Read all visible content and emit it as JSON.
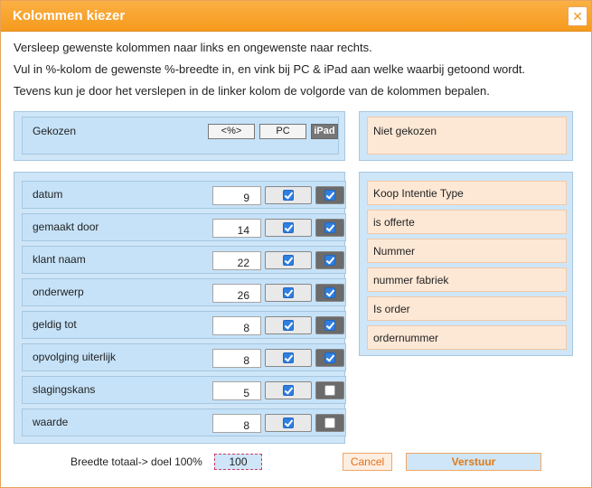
{
  "dialog": {
    "title": "Kolommen kiezer",
    "close_label": "✕"
  },
  "instructions": [
    "Versleep gewenste kolommen naar links en ongewenste naar rechts.",
    "Vul in %-kolom de gewenste %-breedte in, en vink bij PC & iPad aan welke waarbij getoond wordt.",
    "Tevens kun je door het verslepen in de linker kolom de volgorde van de kolommen bepalen."
  ],
  "chosen": {
    "header_label": "Gekozen",
    "col_percent": "<%>",
    "col_pc": "PC",
    "col_ipad": "iPad",
    "rows": [
      {
        "label": "datum",
        "percent": "9",
        "pc": true,
        "ipad": true
      },
      {
        "label": "gemaakt door",
        "percent": "14",
        "pc": true,
        "ipad": true
      },
      {
        "label": "klant naam",
        "percent": "22",
        "pc": true,
        "ipad": true
      },
      {
        "label": "onderwerp",
        "percent": "26",
        "pc": true,
        "ipad": true
      },
      {
        "label": "geldig tot",
        "percent": "8",
        "pc": true,
        "ipad": true
      },
      {
        "label": "opvolging uiterlijk",
        "percent": "8",
        "pc": true,
        "ipad": true
      },
      {
        "label": "slagingskans",
        "percent": "5",
        "pc": true,
        "ipad": false
      },
      {
        "label": "waarde",
        "percent": "8",
        "pc": true,
        "ipad": false
      }
    ]
  },
  "not_chosen": {
    "header_label": "Niet gekozen",
    "items": [
      "Koop Intentie Type",
      "is offerte",
      "Nummer",
      "nummer fabriek",
      "Is order",
      "ordernummer"
    ]
  },
  "footer": {
    "total_label": "Breedte totaal-> doel 100%",
    "total_value": "100",
    "cancel_label": "Cancel",
    "send_label": "Verstuur"
  },
  "colors": {
    "accent": "#f59a1d",
    "panel_blue": "#cfe6f8",
    "panel_peach": "#fde8d6",
    "checkbox_blue": "#2f7fe0"
  }
}
